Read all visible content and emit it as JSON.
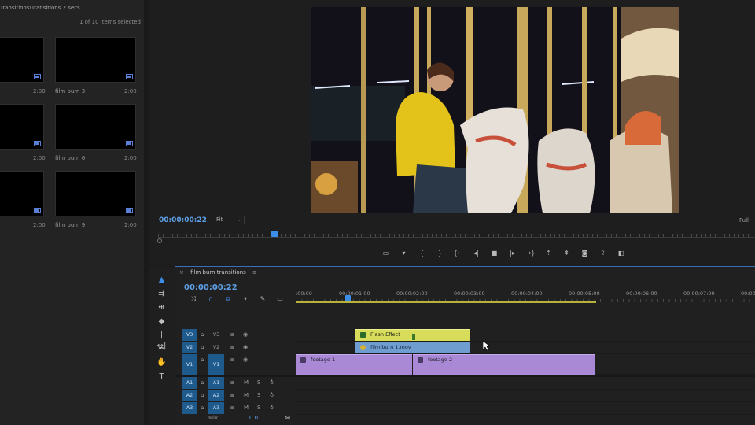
{
  "project": {
    "path": "Transitions\\Transitions 2 secs",
    "selection": "1 of 10 items selected",
    "items": [
      {
        "name": "",
        "duration": "2:00"
      },
      {
        "name": "film burn 3",
        "duration": "2:00"
      },
      {
        "name": "",
        "duration": "2:00"
      },
      {
        "name": "film burn 6",
        "duration": "2:00"
      },
      {
        "name": "",
        "duration": "2:00"
      },
      {
        "name": "film burn 9",
        "duration": "2:00"
      }
    ]
  },
  "monitor": {
    "timecode": "00:00:00:22",
    "zoom": "Fit",
    "resolution": "Full"
  },
  "transport": {
    "buttons": [
      {
        "icon": "safe-margins-icon",
        "glyph": "▭"
      },
      {
        "icon": "marker-icon",
        "glyph": "▾"
      },
      {
        "icon": "mark-in-icon",
        "glyph": "{"
      },
      {
        "icon": "mark-out-icon",
        "glyph": "}"
      },
      {
        "icon": "go-to-in-icon",
        "glyph": "{←"
      },
      {
        "icon": "step-back-icon",
        "glyph": "◂|"
      },
      {
        "icon": "stop-icon",
        "glyph": "■"
      },
      {
        "icon": "step-forward-icon",
        "glyph": "|▸"
      },
      {
        "icon": "go-to-out-icon",
        "glyph": "→}"
      },
      {
        "icon": "lift-icon",
        "glyph": "⇡"
      },
      {
        "icon": "extract-icon",
        "glyph": "⇞"
      },
      {
        "icon": "export-frame-icon",
        "glyph": "◙"
      },
      {
        "icon": "comparison-view-icon",
        "glyph": "⇪"
      },
      {
        "icon": "button-editor-icon",
        "glyph": "◧"
      }
    ]
  },
  "tools": [
    {
      "icon": "selection-tool-icon",
      "glyph": "▲"
    },
    {
      "icon": "track-select-tool-icon",
      "glyph": "⇉"
    },
    {
      "icon": "ripple-edit-tool-icon",
      "glyph": "⇹"
    },
    {
      "icon": "razor-tool-icon",
      "glyph": "◆"
    },
    {
      "icon": "slip-tool-icon",
      "glyph": "|↔|"
    },
    {
      "icon": "pen-tool-icon",
      "glyph": "✒"
    },
    {
      "icon": "hand-tool-icon",
      "glyph": "✋"
    },
    {
      "icon": "type-tool-icon",
      "glyph": "T"
    }
  ],
  "timeline": {
    "sequence_name": "film burn transitions",
    "timecode": "00:00:00:22",
    "ruler": [
      ":00:00",
      "00:00:01:00",
      "00:00:02:00",
      "00:00:03:00",
      "00:00:04:00",
      "00:00:05:00",
      "00:00:06:00",
      "00:00:07:00",
      "00:00"
    ],
    "video_tracks": [
      {
        "source": "V3",
        "target": "V3"
      },
      {
        "source": "V2",
        "target": "V2"
      },
      {
        "source": "V1",
        "target": "V1"
      }
    ],
    "audio_tracks": [
      {
        "source": "A1",
        "target": "A1",
        "mute": "M",
        "solo": "S"
      },
      {
        "source": "A2",
        "target": "A2",
        "mute": "M",
        "solo": "S"
      },
      {
        "source": "A3",
        "target": "A3",
        "mute": "M",
        "solo": "S"
      }
    ],
    "mix": {
      "label": "Mix",
      "value": "0.0"
    },
    "clips": {
      "flash": "Flash Effect",
      "burn": "film burn 1.mov",
      "footage1": "footage 1",
      "footage2": "footage 2"
    },
    "colors": {
      "playhead": "#3d8ee8",
      "flash": "#d7dd5a",
      "burn": "#6f9dd0",
      "footage": "#a988d6"
    }
  }
}
